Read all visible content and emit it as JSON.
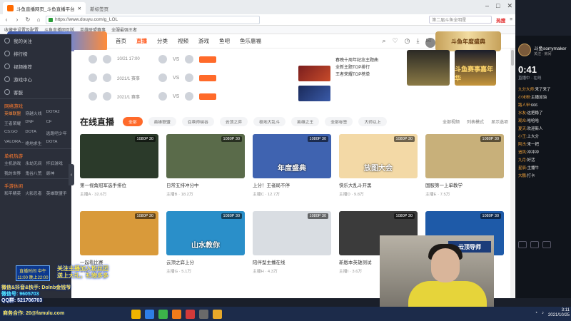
{
  "browser": {
    "tabs": [
      {
        "label": "斗鱼直播网页_斗鱼直播平台"
      },
      {
        "label": "新标签页"
      }
    ],
    "url": "https://www.douyu.com/g_LOL",
    "search_placeholder": "第二届斗鱼全明星",
    "hot_label": "热搜",
    "bookmarks": [
      "收藏夹设置及配置",
      "斗鱼直播网页版",
      "英雄联盟赛事",
      "全服最强王者"
    ]
  },
  "nav": {
    "logo": "斗鱼",
    "items": [
      "首页",
      "直播",
      "分类",
      "视频",
      "游戏",
      "鱼吧",
      "鱼乐惠福"
    ],
    "active_index": 1,
    "banner": "斗鱼年度盛典"
  },
  "sidebar": {
    "items": [
      "我的关注",
      "排行榜",
      "视频推荐",
      "游戏中心",
      "客服"
    ],
    "sections": [
      {
        "title": "网络游戏",
        "games": [
          "英雄联盟",
          "穿越火线",
          "DOTA2",
          "王者荣耀",
          "DNF",
          "CF",
          "CS:GO",
          "DOTA",
          "逃跑吧少年",
          "VALORA...",
          "绝地求生",
          "DOTA"
        ]
      },
      {
        "title": "单机热游",
        "games": [
          "主机游戏",
          "永劫无间",
          "怀旧游戏",
          "我的世界",
          "鬼谷八荒",
          "原神"
        ]
      },
      {
        "title": "手游休闲",
        "games": [
          "和平精英",
          "火影忍者",
          "英雄联盟手游"
        ]
      }
    ]
  },
  "schedule": {
    "matches": [
      {
        "time": "10/21 17:00",
        "score": "VS"
      },
      {
        "time": "2021/1 赛事",
        "score": "VS"
      },
      {
        "time": "2021/1 赛事",
        "score": "VS"
      }
    ],
    "news": [
      "春晚十周年纪念主题曲",
      "全新主题TOP排行",
      "王者荣耀TOP榜单"
    ],
    "promo_label": "斗鱼赛事嘉年华"
  },
  "live": {
    "title": "在线直播",
    "filters": [
      "全部",
      "英雄联盟",
      "召唤师峡谷",
      "云顶之弈",
      "极地大乱斗",
      "英雄之王",
      "全部标签",
      "大师以上"
    ],
    "right_links": [
      "全部视频",
      "列表模式",
      "显示选项"
    ]
  },
  "rooms": [
    {
      "title": "第一视角冠军选手排位",
      "meta": "主播A · 32.6万",
      "badge": "1080P 30",
      "bg": "#2b3a2a",
      "text": ""
    },
    {
      "title": "日常五排冲分中",
      "meta": "主播B · 18.2万",
      "badge": "1080P 30",
      "bg": "#5a6b4a",
      "text": ""
    },
    {
      "title": "上分！王者局不停",
      "meta": "主播C · 12.7万",
      "badge": "1080P 30",
      "bg": "#3f63b0",
      "text": "年度盛典"
    },
    {
      "title": "快乐大乱斗开黑",
      "meta": "主播D · 9.8万",
      "badge": "1080P 30",
      "bg": "#f3d9a6",
      "text": "放图大会"
    },
    {
      "title": "国服第一上单教学",
      "meta": "主播E · 7.5万",
      "badge": "1080P 30",
      "bg": "#c8b07a",
      "text": ""
    },
    {
      "title": "一起看比赛",
      "meta": "主播F · 6.2万",
      "badge": "1080P 30",
      "bg": "#d99a3a",
      "text": ""
    },
    {
      "title": "云顶之弈上分",
      "meta": "主播G · 5.1万",
      "badge": "1080P 30",
      "bg": "#2a8fc9",
      "text": "山水教你"
    },
    {
      "title": "陪伴型主播在线",
      "meta": "主播H · 4.3万",
      "badge": "1080P 30",
      "bg": "#d9dde2",
      "text": ""
    },
    {
      "title": "新版本英雄测试",
      "meta": "主播I · 3.6万",
      "badge": "1080P 30",
      "bg": "#3b3b3b",
      "text": ""
    },
    {
      "title": "云顶导师带你飞",
      "meta": "主播J · 2.9万",
      "badge": "1080P 30",
      "bg": "#1e5aa8",
      "text": "云顶导师"
    }
  ],
  "chat": {
    "streamer": "斗鱼sorrymaker",
    "room_sub": "关注 · 房间",
    "timer": "0:41",
    "timer_sub": "直播中 · 在线",
    "messages": [
      {
        "user": "九分大师:",
        "text": "来了来了"
      },
      {
        "user": "小米粉:",
        "text": "主播加油"
      },
      {
        "user": "路人甲:",
        "text": "666"
      },
      {
        "user": "水友:",
        "text": "这把稳了"
      },
      {
        "user": "观众:",
        "text": "哈哈哈"
      },
      {
        "user": "夏天:",
        "text": "欢迎新人"
      },
      {
        "user": "小王:",
        "text": "上大分"
      },
      {
        "user": "阿杰:",
        "text": "来一把"
      },
      {
        "user": "追风:",
        "text": "冲冲冲"
      },
      {
        "user": "九月:",
        "text": "好活"
      },
      {
        "user": "星辰:",
        "text": "主播牛"
      },
      {
        "user": "大鹏:",
        "text": "打卡"
      }
    ]
  },
  "overlay": {
    "box": "直播时间 中午11:00 晚上22:00",
    "big_lines": [
      "关注主播加入粉丝团",
      "送上大礼，礼物多多"
    ],
    "lines": [
      "微信&抖音&快手: Dolnb金钱爷",
      "微信号: 9605703",
      "QQ群: 521706703"
    ],
    "contact": "商务合作: 20@famulu.com"
  },
  "taskbar": {
    "time": "3:11",
    "date": "2021/10/25"
  },
  "colors": {
    "accent": "#ff5d23",
    "sidebar_bg": "#2b2f3a",
    "chat_bg": "#10141b"
  }
}
